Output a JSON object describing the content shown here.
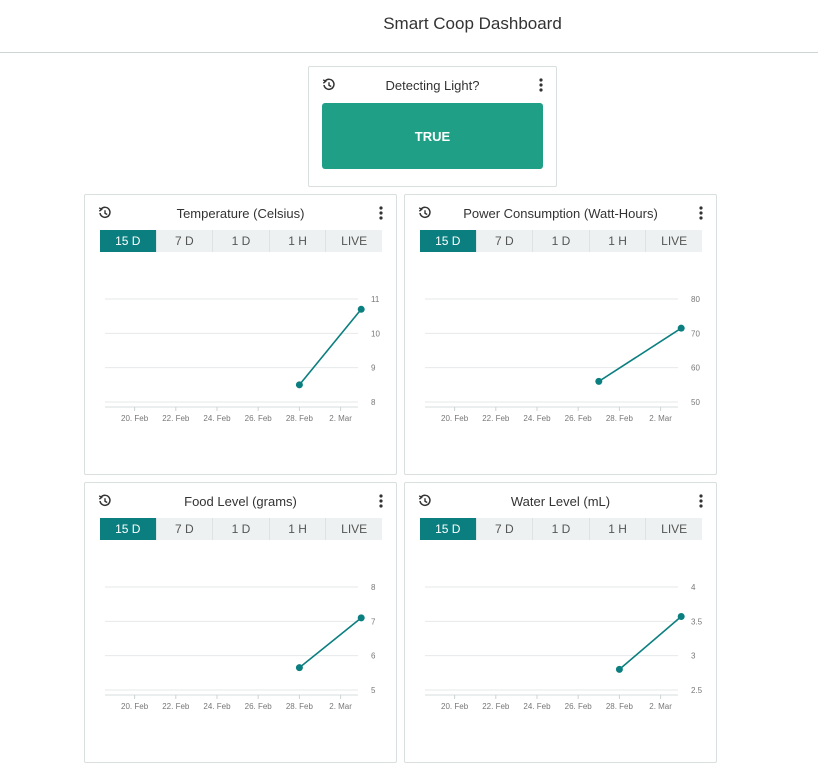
{
  "header": {
    "title": "Smart Coop Dashboard"
  },
  "status_widget": {
    "title": "Detecting Light?",
    "value": "TRUE"
  },
  "colors": {
    "accent": "#0b7f80",
    "status_green": "#1f9f86"
  },
  "icons": {
    "history": "history-icon",
    "menu": "more-vertical-icon"
  },
  "charts": [
    {
      "title": "Temperature (Celsius)",
      "tabs": [
        "15 D",
        "7 D",
        "1 D",
        "1 H",
        "LIVE"
      ],
      "active_tab": "15 D",
      "chart_data": {
        "type": "line",
        "x_ticks": [
          "20. Feb",
          "22. Feb",
          "24. Feb",
          "26. Feb",
          "28. Feb",
          "2. Mar"
        ],
        "y_ticks": [
          "8",
          "9",
          "10",
          "11"
        ],
        "ylim": [
          8,
          11
        ],
        "x": [
          "2021-02-28",
          "2021-03-03"
        ],
        "values": [
          8.5,
          10.7
        ],
        "grid": true
      }
    },
    {
      "title": "Power Consumption (Watt-Hours)",
      "tabs": [
        "15 D",
        "7 D",
        "1 D",
        "1 H",
        "LIVE"
      ],
      "active_tab": "15 D",
      "chart_data": {
        "type": "line",
        "x_ticks": [
          "20. Feb",
          "22. Feb",
          "24. Feb",
          "26. Feb",
          "28. Feb",
          "2. Mar"
        ],
        "y_ticks": [
          "50",
          "60",
          "70",
          "80"
        ],
        "ylim": [
          50,
          80
        ],
        "x": [
          "2021-02-27",
          "2021-03-03"
        ],
        "values": [
          56,
          71.5
        ],
        "grid": true
      }
    },
    {
      "title": "Food Level (grams)",
      "tabs": [
        "15 D",
        "7 D",
        "1 D",
        "1 H",
        "LIVE"
      ],
      "active_tab": "15 D",
      "chart_data": {
        "type": "line",
        "x_ticks": [
          "20. Feb",
          "22. Feb",
          "24. Feb",
          "26. Feb",
          "28. Feb",
          "2. Mar"
        ],
        "y_ticks": [
          "5",
          "6",
          "7",
          "8"
        ],
        "ylim": [
          5,
          8
        ],
        "x": [
          "2021-02-28",
          "2021-03-03"
        ],
        "values": [
          5.65,
          7.1
        ],
        "grid": true
      }
    },
    {
      "title": "Water Level (mL)",
      "tabs": [
        "15 D",
        "7 D",
        "1 D",
        "1 H",
        "LIVE"
      ],
      "active_tab": "15 D",
      "chart_data": {
        "type": "line",
        "x_ticks": [
          "20. Feb",
          "22. Feb",
          "24. Feb",
          "26. Feb",
          "28. Feb",
          "2. Mar"
        ],
        "y_ticks": [
          "2.5",
          "3",
          "3.5",
          "4"
        ],
        "ylim": [
          2.5,
          4
        ],
        "x": [
          "2021-02-28",
          "2021-03-03"
        ],
        "values": [
          2.8,
          3.57
        ],
        "grid": true
      }
    }
  ]
}
